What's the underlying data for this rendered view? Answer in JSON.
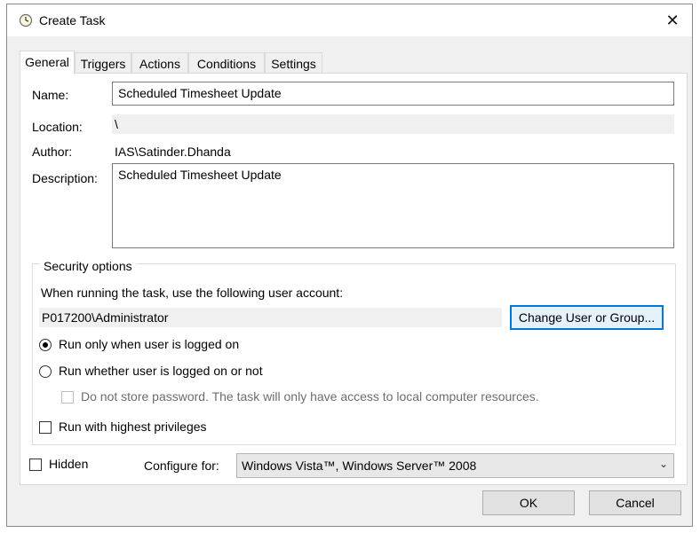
{
  "window": {
    "title": "Create Task",
    "close_glyph": "✕"
  },
  "tabs": [
    {
      "label": "General",
      "active": true
    },
    {
      "label": "Triggers",
      "active": false
    },
    {
      "label": "Actions",
      "active": false
    },
    {
      "label": "Conditions",
      "active": false
    },
    {
      "label": "Settings",
      "active": false
    }
  ],
  "general": {
    "name_label": "Name:",
    "name_value": "Scheduled Timesheet Update",
    "location_label": "Location:",
    "location_value": "\\",
    "author_label": "Author:",
    "author_value": "IAS\\Satinder.Dhanda",
    "description_label": "Description:",
    "description_value": "Scheduled Timesheet Update"
  },
  "security": {
    "title": "Security options",
    "account_prompt": "When running the task, use the following user account:",
    "account_value": "P017200\\Administrator",
    "change_button": "Change User or Group...",
    "radio_logged_on": "Run only when user is logged on",
    "radio_whether": "Run whether user is logged on or not",
    "selected": "logged_on",
    "no_store_password": "Do not store password.  The task will only have access to local computer resources.",
    "highest_privileges": "Run with highest privileges"
  },
  "bottom": {
    "hidden_label": "Hidden",
    "configure_label": "Configure for:",
    "configure_value": "Windows Vista™, Windows Server™ 2008"
  },
  "buttons": {
    "ok": "OK",
    "cancel": "Cancel"
  }
}
